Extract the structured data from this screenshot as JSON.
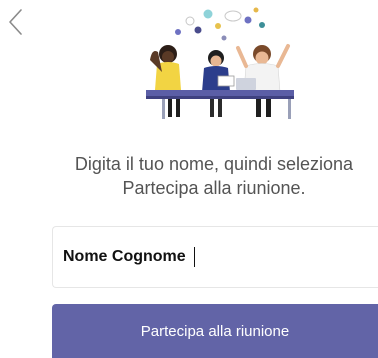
{
  "header": {
    "back_icon": "chevron-left-icon"
  },
  "illustration": {
    "icon": "meeting-people-illustration"
  },
  "prompt": {
    "line1": "Digita il tuo nome, quindi seleziona",
    "line2": "Partecipa alla riunione."
  },
  "name_input": {
    "value": "Nome Cognome"
  },
  "join_button": {
    "label": "Partecipa alla riunione"
  },
  "colors": {
    "accent": "#6264a7",
    "text": "#545454"
  }
}
